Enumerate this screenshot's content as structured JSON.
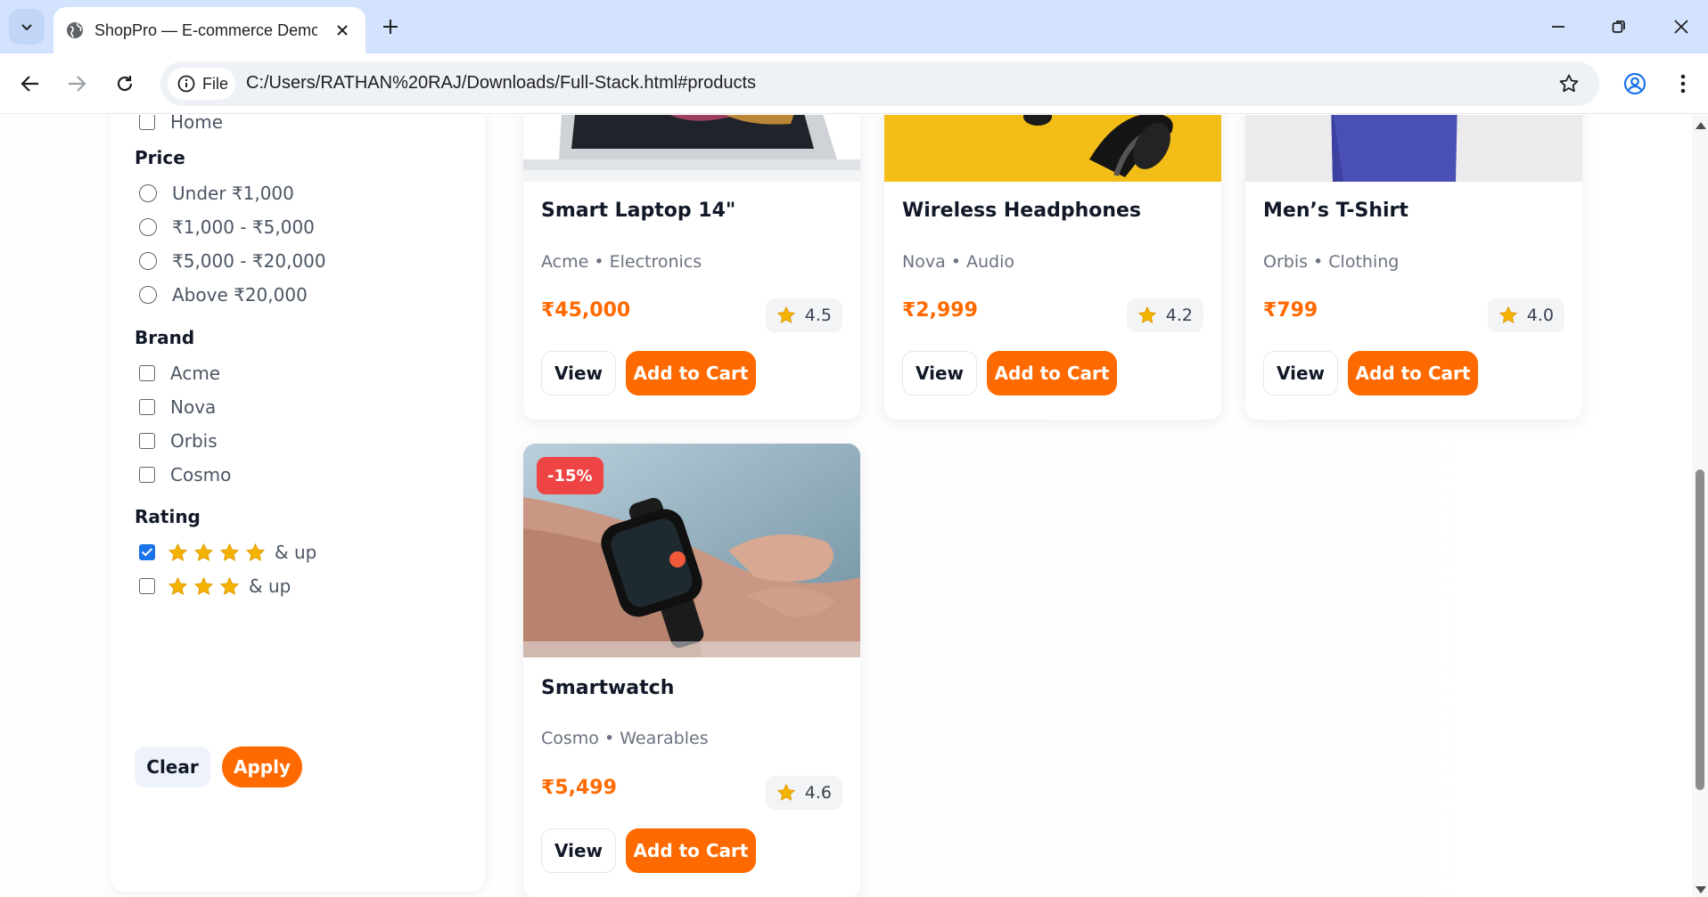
{
  "browser": {
    "tab_title": "ShopPro — E-commerce Demo",
    "site_chip": "File",
    "url": "C:/Users/RATHAN%20RAJ/Downloads/Full-Stack.html#products"
  },
  "filters": {
    "category_partial": {
      "label": "Home",
      "checked": false
    },
    "price": {
      "title": "Price",
      "options": [
        "Under ₹1,000",
        "₹1,000 - ₹5,000",
        "₹5,000 - ₹20,000",
        "Above ₹20,000"
      ]
    },
    "brand": {
      "title": "Brand",
      "options": [
        "Acme",
        "Nova",
        "Orbis",
        "Cosmo"
      ]
    },
    "rating": {
      "title": "Rating",
      "options": [
        {
          "stars": 4,
          "suffix": "& up",
          "checked": true
        },
        {
          "stars": 3,
          "suffix": "& up",
          "checked": false
        }
      ]
    },
    "clear_label": "Clear",
    "apply_label": "Apply"
  },
  "products": [
    {
      "name": "Smart Laptop 14\"",
      "brand": "Acme",
      "category": "Electronics",
      "meta": "Acme • Electronics",
      "price": "₹45,000",
      "rating": "4.5"
    },
    {
      "name": "Wireless Headphones",
      "brand": "Nova",
      "category": "Audio",
      "meta": "Nova • Audio",
      "price": "₹2,999",
      "rating": "4.2"
    },
    {
      "name": "Men’s T-Shirt",
      "brand": "Orbis",
      "category": "Clothing",
      "meta": "Orbis • Clothing",
      "price": "₹799",
      "rating": "4.0"
    },
    {
      "name": "Smartwatch",
      "brand": "Cosmo",
      "category": "Wearables",
      "meta": "Cosmo • Wearables",
      "price": "₹5,499",
      "rating": "4.6",
      "badge": "-15%"
    }
  ],
  "card_actions": {
    "view_label": "View",
    "cart_label": "Add to Cart"
  },
  "colors": {
    "accent": "#ff6a00",
    "badge": "#ef4444",
    "star": "#f5b301",
    "chrome": "#d3e3fd"
  }
}
